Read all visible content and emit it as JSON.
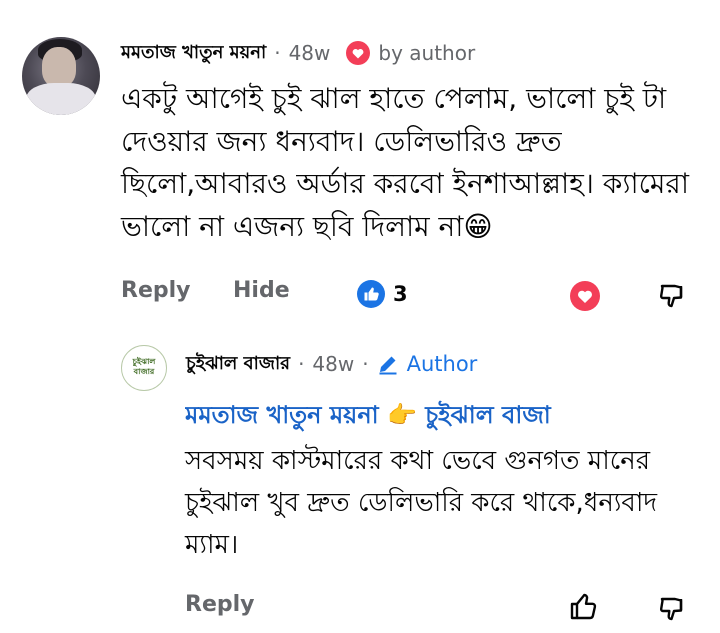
{
  "comment": {
    "author": "মমতাজ খাতুন ময়না",
    "separator": "·",
    "time": "48w",
    "badge": "by author",
    "body": "একটু আগেই চুই ঝাল হাতে পেলাম, ভালো চুই টা দেওয়ার জন্য ধন্যবাদ। ডেলিভারিও দ্রুত ছিলো,আবারও অর্ডার করবো ইনশাআল্লাহ। ক্যামেরা ভালো না এজন্য ছবি দিলাম না😁",
    "actions": {
      "reply": "Reply",
      "hide": "Hide",
      "like_count": "3"
    }
  },
  "reply": {
    "author": "চুইঝাল বাজার",
    "separator": "·",
    "time": "48w",
    "author_badge": "Author",
    "avatar_logo_text": "চুইঝাল বাজার",
    "mention": "মমতাজ খাতুন ময়না 👉 চুইঝাল বাজা",
    "body": "সবসময় কাস্টমারের কথা ভেবে গুনগত মানের চুইঝাল খুব দ্রুত ডেলিভারি করে থাকে,ধন্যবাদ ম্যাম।",
    "actions": {
      "reply": "Reply"
    }
  },
  "colors": {
    "accent_blue": "#1a63c7",
    "like_blue": "#1b74e4",
    "heart_red": "#f33e58",
    "meta_gray": "#65676b"
  },
  "icons": [
    "avatar",
    "heart-icon",
    "like-icon",
    "dislike-icon",
    "pencil-icon",
    "thumbs-up-outline-icon",
    "thumbs-down-outline-icon"
  ]
}
